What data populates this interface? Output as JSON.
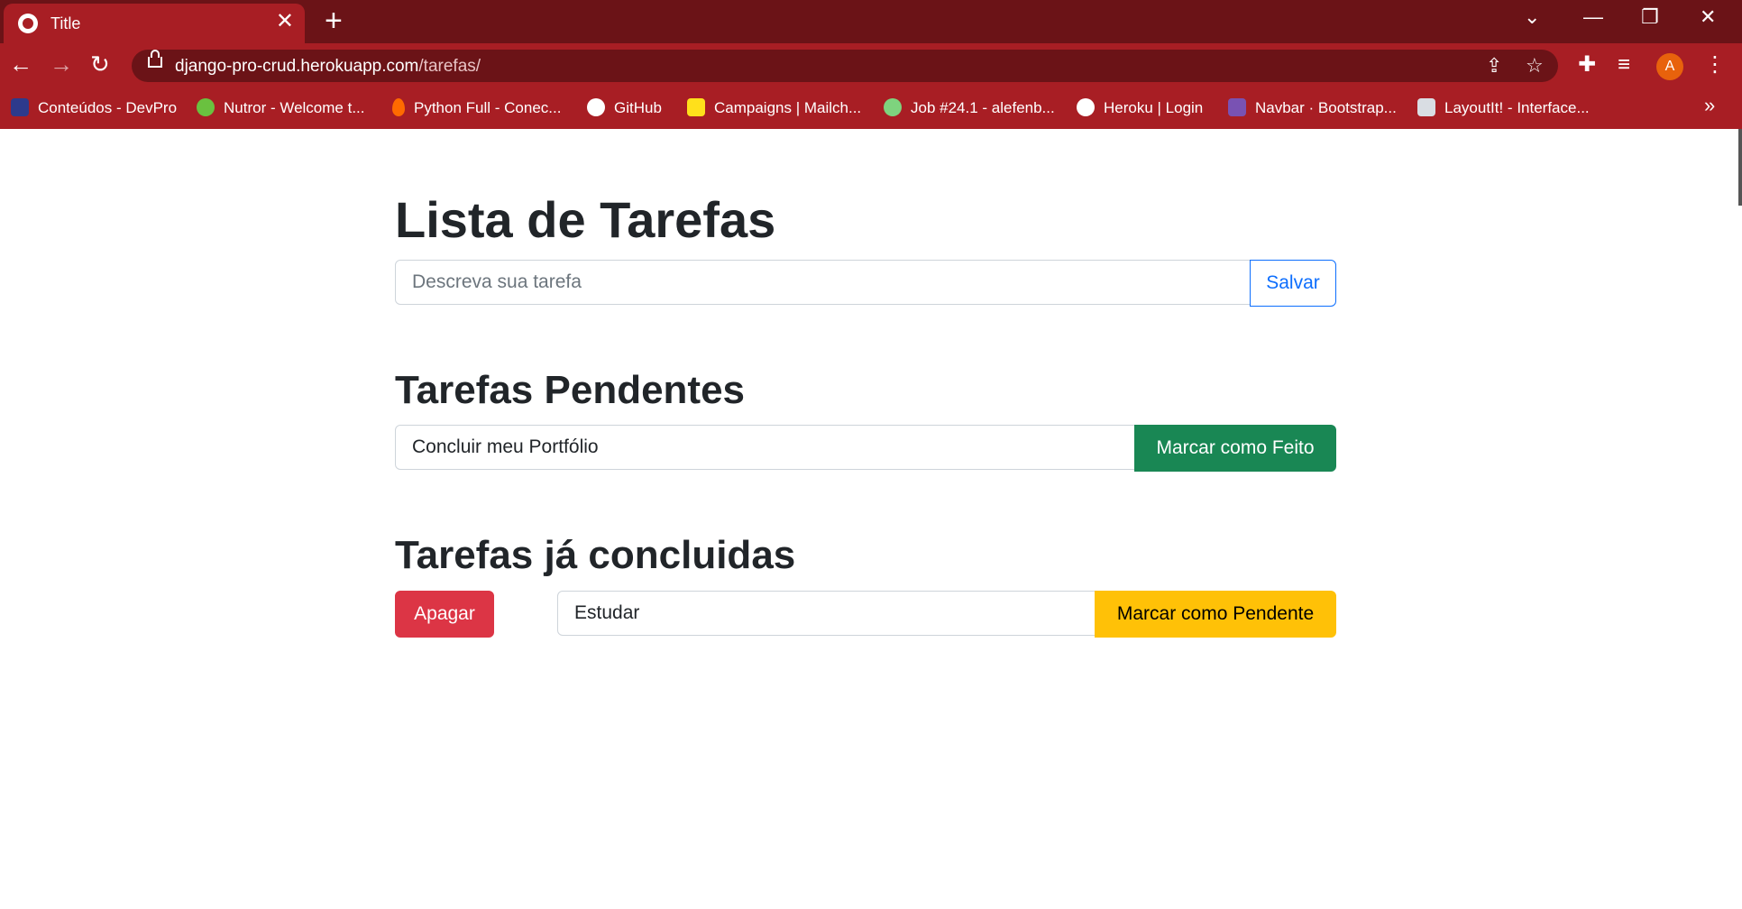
{
  "browser": {
    "tab_title": "Title",
    "tab_close": "✕",
    "new_tab": "+",
    "window_controls": [
      "⌄",
      "—",
      "❐",
      "✕"
    ],
    "url_host": "django-pro-crud.herokuapp.com",
    "url_path": "/tarefas/",
    "profile_initial": "A",
    "accent_color": "#a81e24",
    "bookmarks": [
      {
        "label": "Conteúdos - DevPro",
        "icon": "devpro-icon",
        "color": "#2d3a8c"
      },
      {
        "label": "Nutror - Welcome t...",
        "icon": "nutror-icon",
        "color": "#6ac13f"
      },
      {
        "label": "Python Full - Conec...",
        "icon": "flame-icon",
        "color": "#ff6a00"
      },
      {
        "label": "GitHub",
        "icon": "github-icon",
        "color": "#ffffff"
      },
      {
        "label": "Campaigns | Mailch...",
        "icon": "mailchimp-icon",
        "color": "#ffe01b"
      },
      {
        "label": "Job #24.1 - alefenb...",
        "icon": "gear-icon",
        "color": "#7ed37e"
      },
      {
        "label": "Heroku | Login",
        "icon": "globe-icon",
        "color": "#ffffff"
      },
      {
        "label": "Navbar · Bootstrap...",
        "icon": "bootstrap-icon",
        "color": "#7952b3"
      },
      {
        "label": "LayoutIt! - Interface...",
        "icon": "cube-icon",
        "color": "#d9dde3"
      }
    ],
    "bookmarks_more": "»"
  },
  "page": {
    "title": "Lista de Tarefas",
    "new_task": {
      "placeholder": "Descreva sua tarefa",
      "save_label": "Salvar"
    },
    "pending": {
      "heading": "Tarefas Pendentes",
      "items": [
        {
          "text": "Concluir meu Portfólio",
          "action": "Marcar como Feito"
        }
      ]
    },
    "done": {
      "heading": "Tarefas já concluidas",
      "items": [
        {
          "delete": "Apagar",
          "text": "Estudar",
          "action": "Marcar como Pendente"
        }
      ]
    }
  }
}
